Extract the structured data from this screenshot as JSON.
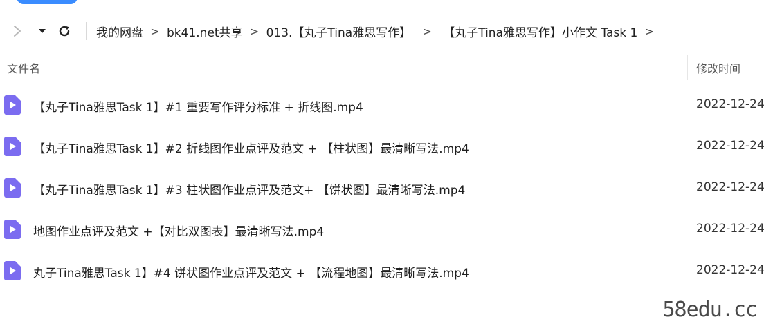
{
  "breadcrumb": [
    {
      "label": "我的网盘"
    },
    {
      "label": "bk41.net共享"
    },
    {
      "label": "013.【丸子Tina雅思写作】"
    },
    {
      "label": "【丸子Tina雅思写作】小作文 Task 1"
    }
  ],
  "breadcrumb_separator": ">",
  "columns": {
    "name": "文件名",
    "modified": "修改时间"
  },
  "files": [
    {
      "name": "【丸子Tina雅思Task 1】#1 重要写作评分标准 + 折线图.mp4",
      "modified": "2022-12-24",
      "icon": "video-file-icon"
    },
    {
      "name": "【丸子Tina雅思Task 1】#2 折线图作业点评及范文 + 【柱状图】最清晰写法.mp4",
      "modified": "2022-12-24",
      "icon": "video-file-icon"
    },
    {
      "name": "【丸子Tina雅思Task 1】#3 柱状图作业点评及范文+ 【饼状图】最清晰写法.mp4",
      "modified": "2022-12-24",
      "icon": "video-file-icon"
    },
    {
      "name": "地图作业点评及范文 +【对比双图表】最清晰写法.mp4",
      "modified": "2022-12-24",
      "icon": "video-file-icon"
    },
    {
      "name": "丸子Tina雅思Task 1】#4 饼状图作业点评及范文 + 【流程地图】最清晰写法.mp4",
      "modified": "2022-12-24",
      "icon": "video-file-icon"
    }
  ],
  "watermark": "58edu.cc",
  "colors": {
    "accent": "#3a8cff",
    "video_icon": "#7b6cf0"
  }
}
